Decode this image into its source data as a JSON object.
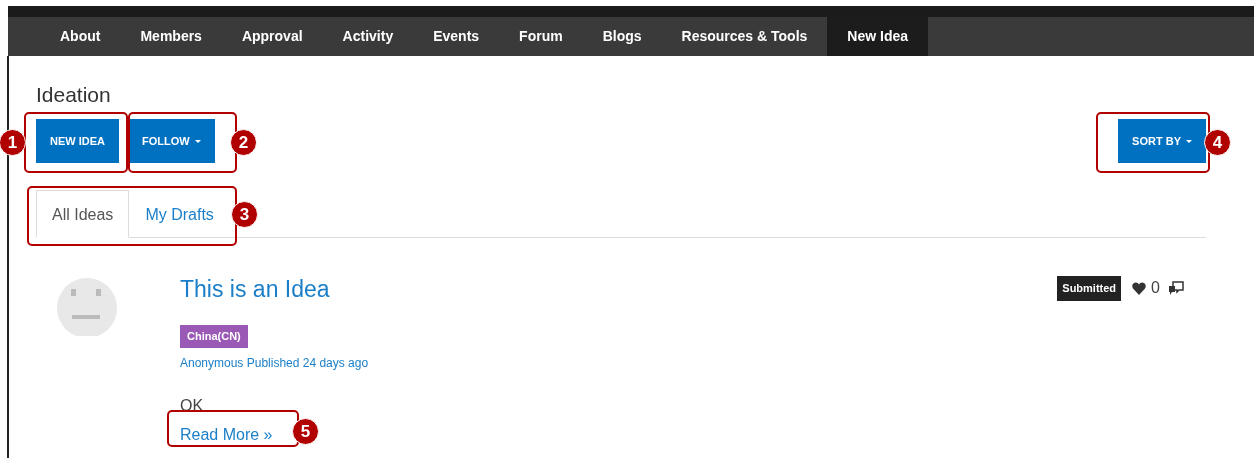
{
  "nav": [
    {
      "label": "About",
      "selected": false
    },
    {
      "label": "Members",
      "selected": false
    },
    {
      "label": "Approval",
      "selected": false
    },
    {
      "label": "Activity",
      "selected": false
    },
    {
      "label": "Events",
      "selected": false
    },
    {
      "label": "Forum",
      "selected": false
    },
    {
      "label": "Blogs",
      "selected": false
    },
    {
      "label": "Resources & Tools",
      "selected": false
    },
    {
      "label": "New Idea",
      "selected": true
    }
  ],
  "page_title": "Ideation",
  "buttons": {
    "new_idea": "NEW IDEA",
    "follow": "FOLLOW",
    "sort_by": "SORT BY"
  },
  "tabs": [
    {
      "label": "All Ideas",
      "selected": true
    },
    {
      "label": "My Drafts",
      "selected": false
    }
  ],
  "ideas": [
    {
      "title": "This is an Idea",
      "status": "Submitted",
      "likes": "0",
      "tag": {
        "label": "China(CN)",
        "color": "#9b59b6"
      },
      "meta": "Anonymous Published 24 days ago",
      "body": "OK",
      "read_more": "Read More »"
    }
  ],
  "callouts": [
    "1",
    "2",
    "3",
    "4",
    "5"
  ]
}
